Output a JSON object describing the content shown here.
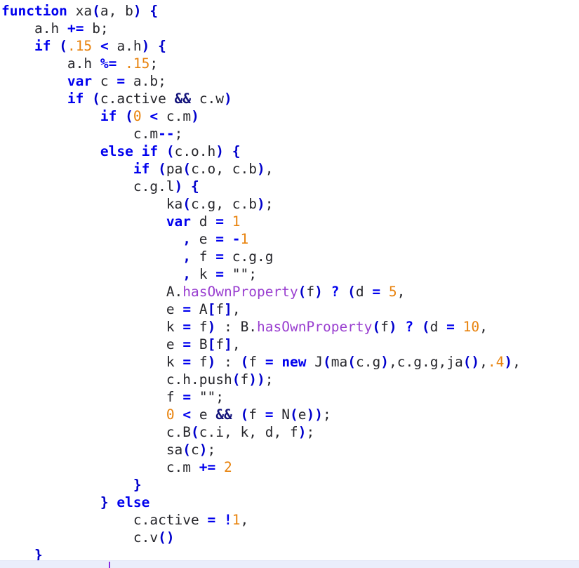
{
  "editor": {
    "language": "javascript",
    "colors": {
      "background": "#ffffff",
      "text": "#26262b",
      "keyword": "#0000ee",
      "number": "#e8820c",
      "function": "#9a3fd0",
      "punctuation": "#0000cc",
      "logical_operator": "#12127a",
      "status_strip": "#eaeefb",
      "status_caret": "#8a2be2"
    }
  },
  "code": {
    "lines": [
      "function xa(a, b) {",
      "    a.h += b;",
      "    if (.15 < a.h) {",
      "        a.h %= .15;",
      "        var c = a.b;",
      "        if (c.active && c.w)",
      "            if (0 < c.m)",
      "                c.m--;",
      "            else if (c.o.h) {",
      "                if (pa(c.o, c.b),",
      "                c.g.l) {",
      "                    ka(c.g, c.b);",
      "                    var d = 1",
      "                      , e = -1",
      "                      , f = c.g.g",
      "                      , k = \"\";",
      "                    A.hasOwnProperty(f) ? (d = 5,",
      "                    e = A[f],",
      "                    k = f) : B.hasOwnProperty(f) ? (d = 10,",
      "                    e = B[f],",
      "                    k = f) : (f = new J(ma(c.g),c.g.g,ja(),.4),",
      "                    c.h.push(f));",
      "                    f = \"\";",
      "                    0 < e && (f = N(e));",
      "                    c.B(c.i, k, d, f);",
      "                    sa(c);",
      "                    c.m += 2",
      "                }",
      "            } else",
      "                c.active = !1,",
      "                c.v()",
      "    }"
    ]
  },
  "status_bar": {
    "caret_label": ""
  }
}
